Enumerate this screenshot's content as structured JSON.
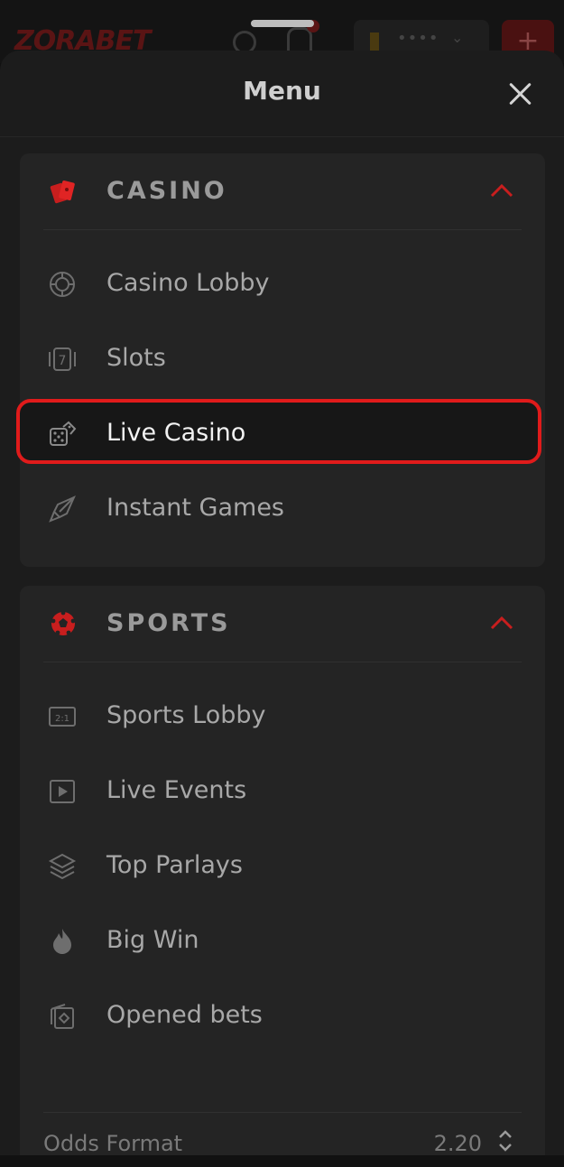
{
  "background_header": {
    "logo": "ZORABET",
    "language_dots": "••••",
    "plus_label": "+"
  },
  "sheet": {
    "title": "Menu"
  },
  "casino": {
    "title": "CASINO",
    "icon": "cards-icon",
    "items": [
      {
        "label": "Casino Lobby",
        "icon": "chip-icon"
      },
      {
        "label": "Slots",
        "icon": "slot-seven-icon"
      },
      {
        "label": "Live Casino",
        "icon": "dice-icon",
        "active": true
      },
      {
        "label": "Instant Games",
        "icon": "rocket-icon"
      }
    ]
  },
  "sports": {
    "title": "SPORTS",
    "icon": "soccer-ball-icon",
    "items": [
      {
        "label": "Sports Lobby",
        "icon": "scoreboard-icon"
      },
      {
        "label": "Live Events",
        "icon": "play-icon"
      },
      {
        "label": "Top Parlays",
        "icon": "layers-icon"
      },
      {
        "label": "Big Win",
        "icon": "flame-icon"
      },
      {
        "label": "Opened bets",
        "icon": "bet-slip-icon"
      }
    ]
  },
  "odds": {
    "label": "Odds Format",
    "value": "2.20"
  },
  "colors": {
    "accent": "#e01b1b",
    "sheet_bg": "#1c1c1c",
    "card_bg": "#242424"
  }
}
